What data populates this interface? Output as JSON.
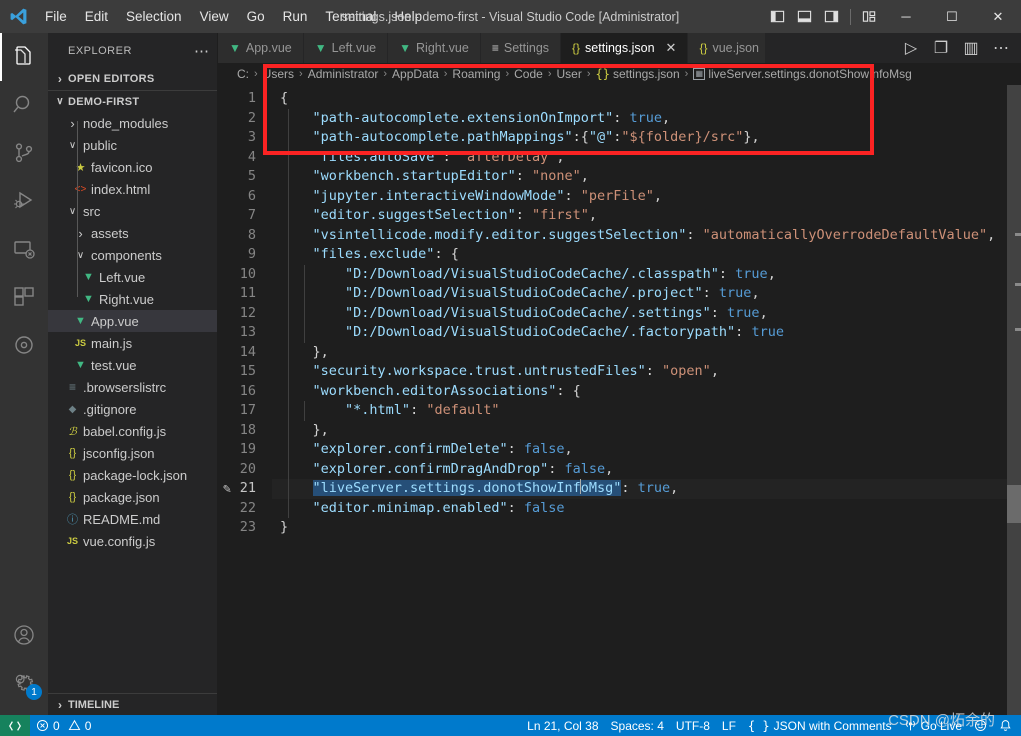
{
  "titlebar": {
    "logo_icon": "vscode-logo-icon",
    "menus": [
      "File",
      "Edit",
      "Selection",
      "View",
      "Go",
      "Run",
      "Terminal",
      "Help"
    ],
    "window_title": "settings.json - demo-first - Visual Studio Code [Administrator]",
    "layout_buttons": [
      {
        "name": "toggle-primary-sidebar",
        "icon": "panel-left-icon"
      },
      {
        "name": "toggle-panel",
        "icon": "panel-bottom-icon"
      },
      {
        "name": "toggle-secondary-sidebar",
        "icon": "panel-right-icon"
      },
      {
        "name": "customize-layout",
        "icon": "layout-grid-icon"
      }
    ],
    "window_controls": [
      {
        "name": "minimize-button",
        "glyph": "─"
      },
      {
        "name": "maximize-button",
        "glyph": "☐"
      },
      {
        "name": "close-button",
        "glyph": "✕"
      }
    ]
  },
  "activitybar": {
    "items": [
      {
        "name": "explorer",
        "icon": "files-icon",
        "active": true
      },
      {
        "name": "search",
        "icon": "search-icon",
        "active": false
      },
      {
        "name": "source-control",
        "icon": "source-control-icon",
        "active": false
      },
      {
        "name": "run-and-debug",
        "icon": "run-debug-icon",
        "active": false
      },
      {
        "name": "remote-explorer",
        "icon": "remote-explorer-icon",
        "active": false
      },
      {
        "name": "extensions",
        "icon": "extensions-icon",
        "active": false
      },
      {
        "name": "live-share",
        "icon": "circle-target-icon",
        "active": false
      }
    ],
    "bottom": [
      {
        "name": "accounts",
        "icon": "account-icon",
        "badge": ""
      },
      {
        "name": "manage-settings",
        "icon": "gear-icon",
        "badge": "1"
      }
    ]
  },
  "sidebar": {
    "title": "EXPLORER",
    "more_actions_icon": "ellipsis-icon",
    "open_editors": {
      "label": "OPEN EDITORS",
      "expanded": false,
      "chevron": "›"
    },
    "project": {
      "label": "DEMO-FIRST",
      "expanded": true,
      "chevron": "∨"
    },
    "tree": [
      {
        "label": "node_modules",
        "type": "folder",
        "indent": 2,
        "expanded": false,
        "icon": "chevron-right-icon",
        "selected": false
      },
      {
        "label": "public",
        "type": "folder",
        "indent": 2,
        "expanded": true,
        "icon": "chevron-down-icon",
        "selected": false
      },
      {
        "label": "favicon.ico",
        "type": "file",
        "indent": 3,
        "icon": "star-icon",
        "icon_color": "#cbcb41",
        "selected": false
      },
      {
        "label": "index.html",
        "type": "file",
        "indent": 3,
        "icon": "html-icon",
        "icon_color": "#e44d26",
        "selected": false
      },
      {
        "label": "src",
        "type": "folder",
        "indent": 2,
        "expanded": true,
        "icon": "chevron-down-icon",
        "selected": false
      },
      {
        "label": "assets",
        "type": "folder",
        "indent": 3,
        "expanded": false,
        "icon": "chevron-right-icon",
        "selected": false
      },
      {
        "label": "components",
        "type": "folder",
        "indent": 3,
        "expanded": true,
        "icon": "chevron-down-icon",
        "selected": false
      },
      {
        "label": "Left.vue",
        "type": "file",
        "indent": 4,
        "icon": "vue-icon",
        "icon_color": "#41b883",
        "selected": false
      },
      {
        "label": "Right.vue",
        "type": "file",
        "indent": 4,
        "icon": "vue-icon",
        "icon_color": "#41b883",
        "selected": false
      },
      {
        "label": "App.vue",
        "type": "file",
        "indent": 3,
        "icon": "vue-icon",
        "icon_color": "#41b883",
        "selected": true
      },
      {
        "label": "main.js",
        "type": "file",
        "indent": 3,
        "icon": "js-icon",
        "icon_color": "#cbcb41",
        "selected": false
      },
      {
        "label": "test.vue",
        "type": "file",
        "indent": 3,
        "icon": "vue-icon",
        "icon_color": "#41b883",
        "selected": false
      },
      {
        "label": ".browserslistrc",
        "type": "file",
        "indent": 2,
        "icon": "lines-icon",
        "icon_color": "#6d8086",
        "selected": false
      },
      {
        "label": ".gitignore",
        "type": "file",
        "indent": 2,
        "icon": "diamond-icon",
        "icon_color": "#6d8086",
        "selected": false
      },
      {
        "label": "babel.config.js",
        "type": "file",
        "indent": 2,
        "icon": "babel-icon",
        "icon_color": "#cbcb41",
        "selected": false
      },
      {
        "label": "jsconfig.json",
        "type": "file",
        "indent": 2,
        "icon": "json-icon",
        "icon_color": "#cbcb41",
        "selected": false
      },
      {
        "label": "package-lock.json",
        "type": "file",
        "indent": 2,
        "icon": "json-icon",
        "icon_color": "#cbcb41",
        "selected": false
      },
      {
        "label": "package.json",
        "type": "file",
        "indent": 2,
        "icon": "json-icon",
        "icon_color": "#cbcb41",
        "selected": false
      },
      {
        "label": "README.md",
        "type": "file",
        "indent": 2,
        "icon": "info-icon",
        "icon_color": "#519aba",
        "selected": false
      },
      {
        "label": "vue.config.js",
        "type": "file",
        "indent": 2,
        "icon": "js-icon",
        "icon_color": "#cbcb41",
        "selected": false
      }
    ],
    "timeline": {
      "label": "TIMELINE",
      "chevron": "›"
    }
  },
  "tabs": [
    {
      "label": "App.vue",
      "icon": "vue-icon",
      "icon_color": "#41b883",
      "active": false,
      "close": false
    },
    {
      "label": "Left.vue",
      "icon": "vue-icon",
      "icon_color": "#41b883",
      "active": false,
      "close": false
    },
    {
      "label": "Right.vue",
      "icon": "vue-icon",
      "icon_color": "#41b883",
      "active": false,
      "close": false
    },
    {
      "label": "Settings",
      "icon": "settings-lines-icon",
      "icon_color": "#cccccc",
      "active": false,
      "close": false
    },
    {
      "label": "settings.json",
      "icon": "json-icon",
      "icon_color": "#cbcb41",
      "active": true,
      "close": true,
      "close_glyph": "✕"
    },
    {
      "label": "vue.json",
      "icon": "json-icon",
      "icon_color": "#cbcb41",
      "active": false,
      "close": false
    }
  ],
  "tab_actions": [
    {
      "name": "run-code-button",
      "icon": "play-icon",
      "glyph": "▷"
    },
    {
      "name": "open-changes-button",
      "icon": "file-copy-icon",
      "glyph": "❐"
    },
    {
      "name": "split-editor-button",
      "icon": "split-editor-icon",
      "glyph": "▥"
    },
    {
      "name": "more-actions-button",
      "icon": "ellipsis-icon",
      "glyph": "⋯"
    }
  ],
  "breadcrumbs": [
    {
      "label": "C:",
      "icon": ""
    },
    {
      "label": "Users",
      "icon": ""
    },
    {
      "label": "Administrator",
      "icon": ""
    },
    {
      "label": "AppData",
      "icon": ""
    },
    {
      "label": "Roaming",
      "icon": ""
    },
    {
      "label": "Code",
      "icon": ""
    },
    {
      "label": "User",
      "icon": ""
    },
    {
      "label": "settings.json",
      "icon": "json-icon"
    },
    {
      "label": "liveServer.settings.donotShowInfoMsg",
      "icon": "symbol-boolean-icon"
    }
  ],
  "breadcrumb_separator": "›",
  "editor": {
    "language": "JSON with Comments",
    "total_lines": 23,
    "current_line": 21,
    "lines": [
      {
        "n": 1,
        "indent": 0,
        "tokens": [
          {
            "t": "{",
            "c": "p"
          }
        ]
      },
      {
        "n": 2,
        "indent": 1,
        "tokens": [
          {
            "t": "\"path-autocomplete.extensionOnImport\"",
            "c": "k"
          },
          {
            "t": ": ",
            "c": "p"
          },
          {
            "t": "true",
            "c": "b"
          },
          {
            "t": ",",
            "c": "p"
          }
        ]
      },
      {
        "n": 3,
        "indent": 1,
        "tokens": [
          {
            "t": "\"path-autocomplete.pathMappings\"",
            "c": "k"
          },
          {
            "t": ":{",
            "c": "p"
          },
          {
            "t": "\"@\"",
            "c": "k"
          },
          {
            "t": ":",
            "c": "p"
          },
          {
            "t": "\"${folder}/src\"",
            "c": "s"
          },
          {
            "t": "},",
            "c": "p"
          }
        ]
      },
      {
        "n": 4,
        "indent": 1,
        "tokens": [
          {
            "t": "\"files.autoSave\"",
            "c": "k"
          },
          {
            "t": ": ",
            "c": "p"
          },
          {
            "t": "\"afterDelay\"",
            "c": "s"
          },
          {
            "t": ",",
            "c": "p"
          }
        ]
      },
      {
        "n": 5,
        "indent": 1,
        "tokens": [
          {
            "t": "\"workbench.startupEditor\"",
            "c": "k"
          },
          {
            "t": ": ",
            "c": "p"
          },
          {
            "t": "\"none\"",
            "c": "s"
          },
          {
            "t": ",",
            "c": "p"
          }
        ]
      },
      {
        "n": 6,
        "indent": 1,
        "tokens": [
          {
            "t": "\"jupyter.interactiveWindowMode\"",
            "c": "k"
          },
          {
            "t": ": ",
            "c": "p"
          },
          {
            "t": "\"perFile\"",
            "c": "s"
          },
          {
            "t": ",",
            "c": "p"
          }
        ]
      },
      {
        "n": 7,
        "indent": 1,
        "tokens": [
          {
            "t": "\"editor.suggestSelection\"",
            "c": "k"
          },
          {
            "t": ": ",
            "c": "p"
          },
          {
            "t": "\"first\"",
            "c": "s"
          },
          {
            "t": ",",
            "c": "p"
          }
        ]
      },
      {
        "n": 8,
        "indent": 1,
        "tokens": [
          {
            "t": "\"vsintellicode.modify.editor.suggestSelection\"",
            "c": "k"
          },
          {
            "t": ": ",
            "c": "p"
          },
          {
            "t": "\"automaticallyOverrodeDefaultValue\"",
            "c": "s"
          },
          {
            "t": ",",
            "c": "p"
          }
        ]
      },
      {
        "n": 9,
        "indent": 1,
        "tokens": [
          {
            "t": "\"files.exclude\"",
            "c": "k"
          },
          {
            "t": ": {",
            "c": "p"
          }
        ]
      },
      {
        "n": 10,
        "indent": 2,
        "tokens": [
          {
            "t": "\"D:/Download/VisualStudioCodeCache/.classpath\"",
            "c": "k"
          },
          {
            "t": ": ",
            "c": "p"
          },
          {
            "t": "true",
            "c": "b"
          },
          {
            "t": ",",
            "c": "p"
          }
        ]
      },
      {
        "n": 11,
        "indent": 2,
        "tokens": [
          {
            "t": "\"D:/Download/VisualStudioCodeCache/.project\"",
            "c": "k"
          },
          {
            "t": ": ",
            "c": "p"
          },
          {
            "t": "true",
            "c": "b"
          },
          {
            "t": ",",
            "c": "p"
          }
        ]
      },
      {
        "n": 12,
        "indent": 2,
        "tokens": [
          {
            "t": "\"D:/Download/VisualStudioCodeCache/.settings\"",
            "c": "k"
          },
          {
            "t": ": ",
            "c": "p"
          },
          {
            "t": "true",
            "c": "b"
          },
          {
            "t": ",",
            "c": "p"
          }
        ]
      },
      {
        "n": 13,
        "indent": 2,
        "tokens": [
          {
            "t": "\"D:/Download/VisualStudioCodeCache/.factorypath\"",
            "c": "k"
          },
          {
            "t": ": ",
            "c": "p"
          },
          {
            "t": "true",
            "c": "b"
          }
        ]
      },
      {
        "n": 14,
        "indent": 1,
        "tokens": [
          {
            "t": "},",
            "c": "p"
          }
        ]
      },
      {
        "n": 15,
        "indent": 1,
        "tokens": [
          {
            "t": "\"security.workspace.trust.untrustedFiles\"",
            "c": "k"
          },
          {
            "t": ": ",
            "c": "p"
          },
          {
            "t": "\"open\"",
            "c": "s"
          },
          {
            "t": ",",
            "c": "p"
          }
        ]
      },
      {
        "n": 16,
        "indent": 1,
        "tokens": [
          {
            "t": "\"workbench.editorAssociations\"",
            "c": "k"
          },
          {
            "t": ": {",
            "c": "p"
          }
        ]
      },
      {
        "n": 17,
        "indent": 2,
        "tokens": [
          {
            "t": "\"*.html\"",
            "c": "k"
          },
          {
            "t": ": ",
            "c": "p"
          },
          {
            "t": "\"default\"",
            "c": "s"
          }
        ]
      },
      {
        "n": 18,
        "indent": 1,
        "tokens": [
          {
            "t": "},",
            "c": "p"
          }
        ]
      },
      {
        "n": 19,
        "indent": 1,
        "tokens": [
          {
            "t": "\"explorer.confirmDelete\"",
            "c": "k"
          },
          {
            "t": ": ",
            "c": "p"
          },
          {
            "t": "false",
            "c": "b"
          },
          {
            "t": ",",
            "c": "p"
          }
        ]
      },
      {
        "n": 20,
        "indent": 1,
        "tokens": [
          {
            "t": "\"explorer.confirmDragAndDrop\"",
            "c": "k"
          },
          {
            "t": ": ",
            "c": "p"
          },
          {
            "t": "false",
            "c": "b"
          },
          {
            "t": ",",
            "c": "p"
          }
        ]
      },
      {
        "n": 21,
        "indent": 1,
        "current": true,
        "tokens": [
          {
            "t": "\"liveServer.settings.donotShowInf",
            "c": "k sel"
          },
          {
            "t": "CURSOR",
            "c": "cursor"
          },
          {
            "t": "oMsg\"",
            "c": "k sel"
          },
          {
            "t": ": ",
            "c": "p"
          },
          {
            "t": "true",
            "c": "b"
          },
          {
            "t": ",",
            "c": "p"
          }
        ]
      },
      {
        "n": 22,
        "indent": 1,
        "tokens": [
          {
            "t": "\"editor.minimap.enabled\"",
            "c": "k"
          },
          {
            "t": ": ",
            "c": "p"
          },
          {
            "t": "false",
            "c": "b"
          }
        ]
      },
      {
        "n": 23,
        "indent": 0,
        "tokens": [
          {
            "t": "}",
            "c": "p"
          }
        ]
      }
    ],
    "gutter_edit_icon": {
      "line": 21,
      "icon": "pencil-icon",
      "glyph": "✎"
    }
  },
  "statusbar": {
    "remote_icon": "remote-indicator-icon",
    "errors": {
      "icon": "error-icon",
      "count": "0"
    },
    "warnings": {
      "icon": "warning-icon",
      "count": "0"
    },
    "right": [
      {
        "name": "editor-position",
        "label": "Ln 21, Col 38"
      },
      {
        "name": "indentation",
        "label": "Spaces: 4"
      },
      {
        "name": "encoding",
        "label": "UTF-8"
      },
      {
        "name": "eol",
        "label": "LF"
      },
      {
        "name": "language-mode",
        "label": "JSON with Comments",
        "icon": "json-icon"
      },
      {
        "name": "go-live",
        "label": "Go Live",
        "icon": "broadcast-icon"
      },
      {
        "name": "feedback",
        "label": "",
        "icon": "smiley-icon"
      },
      {
        "name": "notifications",
        "label": "",
        "icon": "bell-icon"
      }
    ]
  },
  "annotation": {
    "name": "red-highlight-rectangle",
    "color": "#fb2323"
  },
  "watermark": {
    "text": "CSDN @炻余的"
  },
  "colors": {
    "accent": "#007acc",
    "titlebar_bg": "#3c3c3c",
    "activitybar_bg": "#333333",
    "sidebar_bg": "#252526",
    "editor_bg": "#1e1e1e",
    "remote_green": "#16825d"
  }
}
